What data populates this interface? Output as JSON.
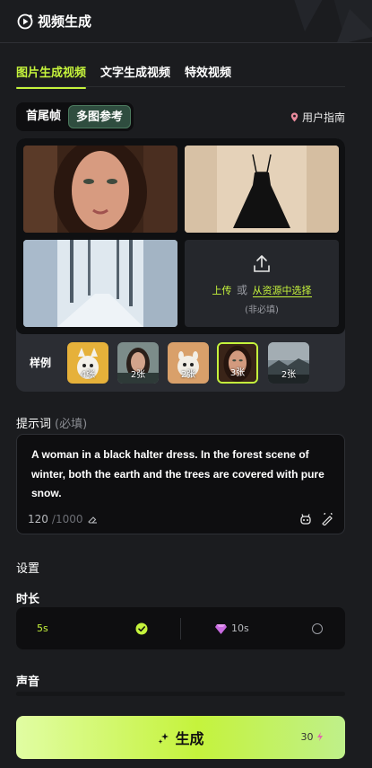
{
  "header": {
    "title": "视频生成"
  },
  "tabs": [
    {
      "label": "图片生成视频",
      "active": true
    },
    {
      "label": "文字生成视频",
      "active": false
    },
    {
      "label": "特效视频",
      "active": false
    }
  ],
  "mode": {
    "options": [
      "首尾帧",
      "多图参考"
    ],
    "selected": "多图参考"
  },
  "guide_link": "用户指南",
  "upload": {
    "upload_label": "上传",
    "or_label": "或",
    "choose_label": "从资源中选择",
    "optional_hint": "(非必填)"
  },
  "examples": {
    "label": "样例",
    "items": [
      {
        "count": "4张",
        "selected": false
      },
      {
        "count": "2张",
        "selected": false
      },
      {
        "count": "2张",
        "selected": false
      },
      {
        "count": "3张",
        "selected": true
      },
      {
        "count": "2张",
        "selected": false
      }
    ]
  },
  "prompt": {
    "label": "提示词",
    "required_hint": "(必填)",
    "text": "A woman in a black halter dress. In the forest scene of winter, both the earth and the trees are covered with pure snow.",
    "char_count": "120",
    "char_max": "/1000"
  },
  "settings": {
    "label": "设置"
  },
  "duration": {
    "label": "时长",
    "options": [
      {
        "value": "5s",
        "selected": true
      },
      {
        "value": "10s",
        "selected": false
      }
    ]
  },
  "sound": {
    "label": "声音"
  },
  "generate": {
    "label": "生成",
    "cost": "30"
  },
  "colors": {
    "accent": "#c5f33c",
    "background": "#1b1c1f",
    "panel": "#2b2d33"
  }
}
